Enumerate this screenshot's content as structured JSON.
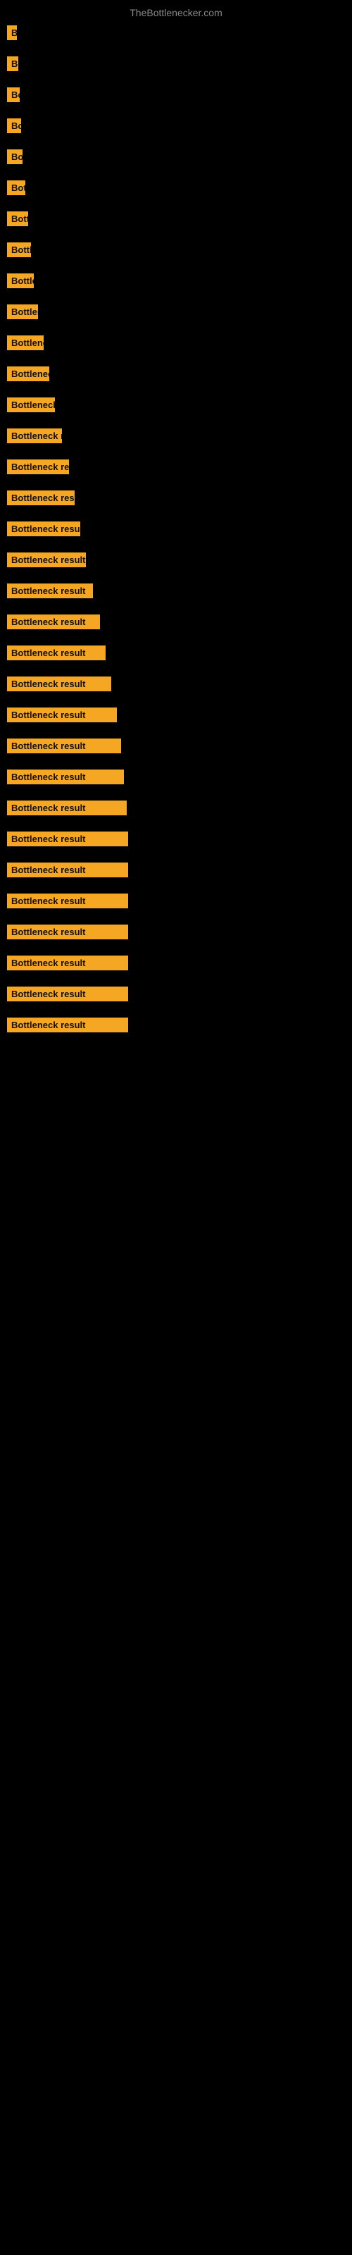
{
  "site": {
    "title": "TheBottlenecker.com"
  },
  "items": [
    {
      "id": 1,
      "label": "Bottleneck result",
      "width": 14,
      "marginTop": 30
    },
    {
      "id": 2,
      "label": "Bottleneck result",
      "width": 16,
      "marginTop": 46
    },
    {
      "id": 3,
      "label": "Bottleneck result",
      "width": 18,
      "marginTop": 46
    },
    {
      "id": 4,
      "label": "Bottleneck result",
      "width": 20,
      "marginTop": 46
    },
    {
      "id": 5,
      "label": "Bottleneck result",
      "width": 22,
      "marginTop": 46
    },
    {
      "id": 6,
      "label": "Bottleneck result",
      "width": 25,
      "marginTop": 46
    },
    {
      "id": 7,
      "label": "Bottleneck result",
      "width": 28,
      "marginTop": 46
    },
    {
      "id": 8,
      "label": "Bottleneck result",
      "width": 32,
      "marginTop": 46
    },
    {
      "id": 9,
      "label": "Bottleneck result",
      "width": 36,
      "marginTop": 46
    },
    {
      "id": 10,
      "label": "Bottleneck result",
      "width": 40,
      "marginTop": 46
    },
    {
      "id": 11,
      "label": "Bottleneck result",
      "width": 50,
      "marginTop": 46
    },
    {
      "id": 12,
      "label": "Bottleneck result",
      "width": 62,
      "marginTop": 46
    },
    {
      "id": 13,
      "label": "Bottleneck result",
      "width": 70,
      "marginTop": 46
    },
    {
      "id": 14,
      "label": "Bottleneck result",
      "width": 82,
      "marginTop": 46
    },
    {
      "id": 15,
      "label": "Bottleneck result",
      "width": 95,
      "marginTop": 46
    },
    {
      "id": 16,
      "label": "Bottleneck result",
      "width": 100,
      "marginTop": 46
    },
    {
      "id": 17,
      "label": "Bottleneck result",
      "width": 110,
      "marginTop": 46
    },
    {
      "id": 18,
      "label": "Bottleneck result",
      "width": 118,
      "marginTop": 46
    },
    {
      "id": 19,
      "label": "Bottleneck result",
      "width": 128,
      "marginTop": 46
    },
    {
      "id": 20,
      "label": "Bottleneck result",
      "width": 138,
      "marginTop": 46
    },
    {
      "id": 21,
      "label": "Bottleneck result",
      "width": 148,
      "marginTop": 46
    },
    {
      "id": 22,
      "label": "Bottleneck result",
      "width": 155,
      "marginTop": 46
    },
    {
      "id": 23,
      "label": "Bottleneck result",
      "width": 160,
      "marginTop": 46
    },
    {
      "id": 24,
      "label": "Bottleneck result",
      "width": 165,
      "marginTop": 46
    },
    {
      "id": 25,
      "label": "Bottleneck result",
      "width": 170,
      "marginTop": 46
    },
    {
      "id": 26,
      "label": "Bottleneck result",
      "width": 172,
      "marginTop": 46
    },
    {
      "id": 27,
      "label": "Bottleneck result",
      "width": 172,
      "marginTop": 46
    },
    {
      "id": 28,
      "label": "Bottleneck result",
      "width": 172,
      "marginTop": 46
    },
    {
      "id": 29,
      "label": "Bottleneck result",
      "width": 172,
      "marginTop": 46
    },
    {
      "id": 30,
      "label": "Bottleneck result",
      "width": 172,
      "marginTop": 46
    },
    {
      "id": 31,
      "label": "Bottleneck result",
      "width": 172,
      "marginTop": 46
    },
    {
      "id": 32,
      "label": "Bottleneck result",
      "width": 172,
      "marginTop": 46
    },
    {
      "id": 33,
      "label": "Bottleneck result",
      "width": 172,
      "marginTop": 46
    }
  ]
}
